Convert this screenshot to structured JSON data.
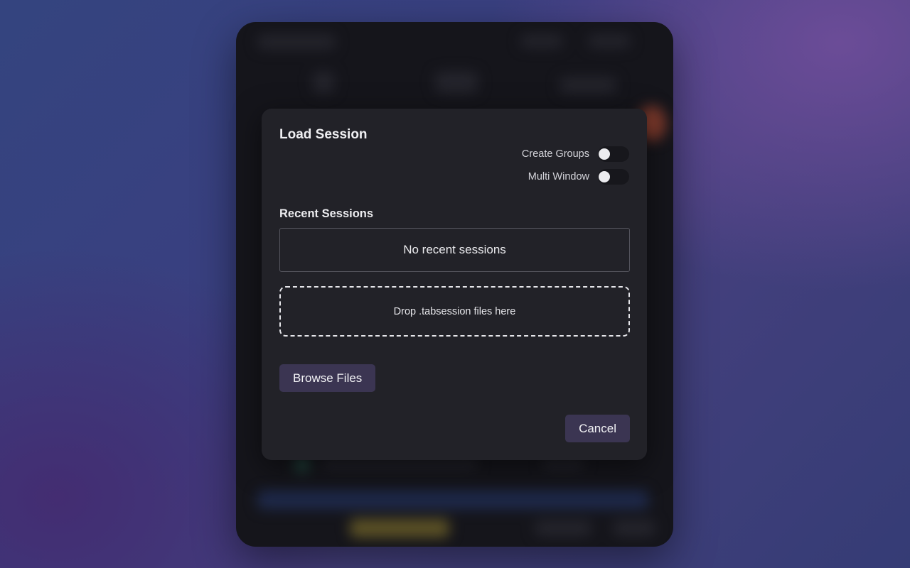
{
  "dialog": {
    "title": "Load Session",
    "options": {
      "create_groups": {
        "label": "Create Groups",
        "enabled": false
      },
      "multi_window": {
        "label": "Multi Window",
        "enabled": false
      }
    },
    "recent": {
      "heading": "Recent Sessions",
      "empty_text": "No recent sessions"
    },
    "drop_zone_text": "Drop .tabsession files here",
    "browse_label": "Browse Files",
    "cancel_label": "Cancel"
  },
  "colors": {
    "dialog_bg": "#222228",
    "button_bg": "#3b3552",
    "toggle_track": "#17171c",
    "toggle_knob": "#ececef"
  }
}
